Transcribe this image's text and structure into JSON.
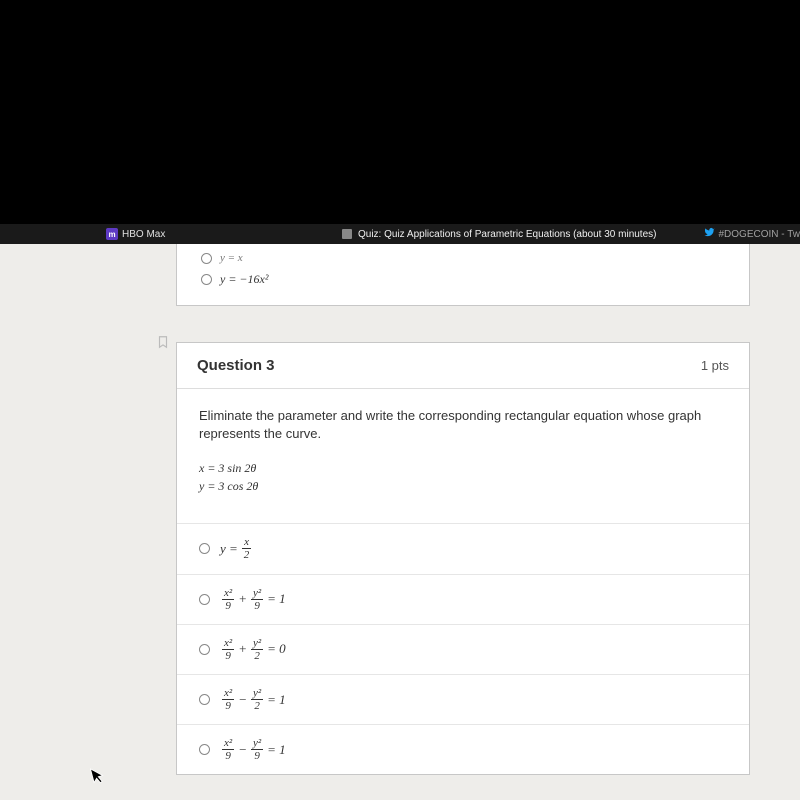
{
  "tabs": {
    "hbo_label": "HBO Max",
    "hbo_icon_text": "m",
    "center_label": "Quiz: Quiz Applications of Parametric Equations (about 30 minutes)",
    "right_label": "#DOGECOIN - Tw"
  },
  "prev_question": {
    "option_cut": "y = x",
    "option_visible": "y = −16x²"
  },
  "question3": {
    "title": "Question 3",
    "points": "1 pts",
    "stem": "Eliminate the parameter and write the corresponding rectangular equation whose graph represents the curve.",
    "given_line1": "x = 3 sin 2θ",
    "given_line2": "y = 3 cos 2θ",
    "options": {
      "a": {
        "lhs": "y =",
        "frac_num": "x",
        "frac_den": "2"
      },
      "b": {
        "t1_num": "x²",
        "t1_den": "9",
        "op": "+",
        "t2_num": "y²",
        "t2_den": "9",
        "rhs": "= 1"
      },
      "c": {
        "t1_num": "x²",
        "t1_den": "9",
        "op": "+",
        "t2_num": "y²",
        "t2_den": "2",
        "rhs": "= 0"
      },
      "d": {
        "t1_num": "x²",
        "t1_den": "9",
        "op": "−",
        "t2_num": "y²",
        "t2_den": "2",
        "rhs": "= 1"
      },
      "e": {
        "t1_num": "x²",
        "t1_den": "9",
        "op": "−",
        "t2_num": "y²",
        "t2_den": "9",
        "rhs": "= 1"
      }
    }
  }
}
